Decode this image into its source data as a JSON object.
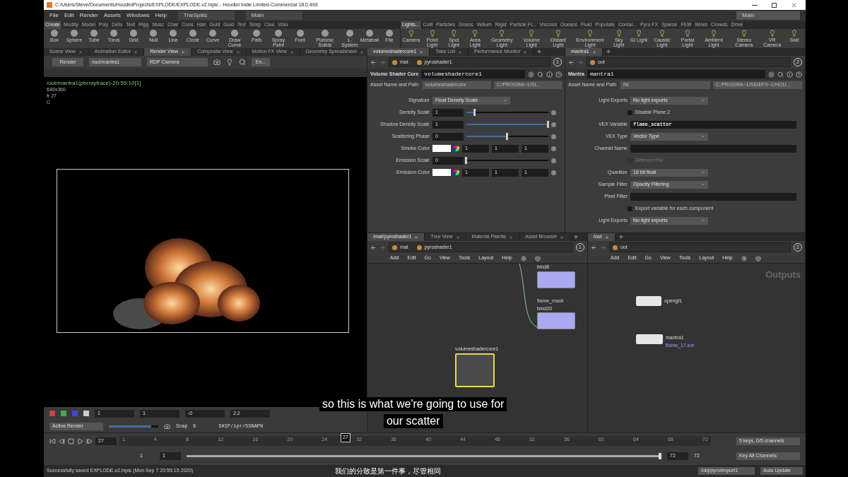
{
  "window": {
    "title": "C:/Users/Steve/Documents/HoudiniProjects/EXPLODE/EXPLODE.v2.hiplc - Houdini Indie Limited-Commercial 18.0.499"
  },
  "menu": [
    "File",
    "Edit",
    "Render",
    "Assets",
    "Windows",
    "Help"
  ],
  "desktops": [
    "TheSplits",
    "Main"
  ],
  "desktop_right": "Main",
  "shelf_left": {
    "tabs": [
      {
        "label": "Create",
        "selected": true
      },
      {
        "label": "Modify",
        "selected": false
      },
      {
        "label": "Model",
        "selected": false
      },
      {
        "label": "Poly",
        "selected": false
      },
      {
        "label": "Defo",
        "selected": false
      },
      {
        "label": "Text",
        "selected": false
      },
      {
        "label": "Rigg",
        "selected": false
      },
      {
        "label": "Musc",
        "selected": false
      },
      {
        "label": "Char",
        "selected": false
      },
      {
        "label": "Cons",
        "selected": false
      },
      {
        "label": "Hair",
        "selected": false
      },
      {
        "label": "Guid",
        "selected": false
      },
      {
        "label": "Guid",
        "selected": false
      },
      {
        "label": "Terr",
        "selected": false
      },
      {
        "label": "Simp",
        "selected": false
      },
      {
        "label": "Clou",
        "selected": false
      },
      {
        "label": "Volu",
        "selected": false
      }
    ],
    "tools": [
      "Box",
      "Sphere",
      "Tube",
      "Torus",
      "Grid",
      "Null",
      "Line",
      "Circle",
      "Curve",
      "Draw Curve",
      "Path",
      "Spray Paint",
      "Font",
      "Platonic Solids",
      "L-System",
      "Metaball",
      "File"
    ]
  },
  "shelf_right": {
    "tabs": [
      {
        "label": "Lights...",
        "selected": true
      },
      {
        "label": "Colli",
        "selected": false
      },
      {
        "label": "Particles",
        "selected": false
      },
      {
        "label": "Grains",
        "selected": false
      },
      {
        "label": "Vellum",
        "selected": false
      },
      {
        "label": "Rigid",
        "selected": false
      },
      {
        "label": "Particle Fl...",
        "selected": false
      },
      {
        "label": "Viscous",
        "selected": false
      },
      {
        "label": "Oceans",
        "selected": false
      },
      {
        "label": "Fluid",
        "selected": false
      },
      {
        "label": "Populate",
        "selected": false
      },
      {
        "label": "Contai...",
        "selected": false
      },
      {
        "label": "Pyro FX",
        "selected": false
      },
      {
        "label": "Sparse",
        "selected": false
      },
      {
        "label": "FEM",
        "selected": false
      },
      {
        "label": "Wires",
        "selected": false
      },
      {
        "label": "Crowds",
        "selected": false
      },
      {
        "label": "Drive",
        "selected": false
      }
    ],
    "tools": [
      "Camera",
      "Point Light",
      "Spot Light",
      "Area Light",
      "Geometry Light",
      "Volume Light",
      "Distant Light",
      "Environment Light",
      "Sky Light",
      "GI Light",
      "Caustic Light",
      "Portal Light",
      "Ambient Light",
      "Stereo Camera",
      "VR Camera",
      "Swit"
    ]
  },
  "viewer": {
    "tabs": [
      {
        "label": "Scene View",
        "selected": false
      },
      {
        "label": "Animation Editor",
        "selected": false
      },
      {
        "label": "Render View",
        "selected": true
      },
      {
        "label": "Composite View",
        "selected": false
      },
      {
        "label": "Motion FX View",
        "selected": false
      },
      {
        "label": "Geometry Spreadsheet",
        "selected": false
      }
    ],
    "render_button": "Render",
    "output": "/out/mantra1",
    "camera": "RDP Camera",
    "en_button": "En...",
    "info": [
      "/out/mantra1(pbrraytrace)-20:55:10[1]",
      "640x360",
      "fr 27",
      "C"
    ],
    "controls": [
      "1",
      "1",
      "-0",
      "2.2"
    ],
    "active_render": "Active Render",
    "snapshot_slider": {
      "level": 0.85
    },
    "snap": "Snap",
    "snap_value": "6",
    "snapshot_path": "SHIP/ipr/SSNAPN"
  },
  "params_panel": {
    "tabs": [
      {
        "label": "volumeshadercore1",
        "selected": true
      },
      {
        "label": "Take List",
        "selected": false
      },
      {
        "label": "Performance Monitor",
        "selected": false
      }
    ],
    "path": [
      "mat",
      "pyroshader1"
    ],
    "pin": "1",
    "node_type": "Volume Shader Core",
    "node_name": "volumeshadercore1",
    "asset_label": "Asset Name and Path",
    "asset_name": "volumeshadercore",
    "asset_path": "C:/PROGRA~1/SI...",
    "params": [
      {
        "kind": "menu",
        "label": "Signature",
        "value": "Float Density Scale"
      },
      {
        "kind": "slider",
        "label": "Density Scale",
        "value": "1",
        "level": 0.1
      },
      {
        "kind": "slider",
        "label": "Shadow Density Scale",
        "value": "1",
        "level": 1
      },
      {
        "kind": "slider",
        "label": "Scattering Phase",
        "value": "0",
        "level": 0.5
      },
      {
        "kind": "color",
        "label": "Smoke Color",
        "values": [
          "1",
          "1",
          "1"
        ]
      },
      {
        "kind": "slider",
        "label": "Emission Scale",
        "value": "0",
        "level": 0
      },
      {
        "kind": "color",
        "label": "Emission Color",
        "values": [
          "1",
          "1",
          "1"
        ]
      }
    ]
  },
  "mantra_panel": {
    "tabs": [
      {
        "label": "mantra1",
        "selected": true
      }
    ],
    "path": [
      "out"
    ],
    "pin": "2",
    "node_type": "Mantra",
    "node_name": "mantra1",
    "asset_label": "Asset Name and Path",
    "asset_name": "ifd",
    "asset_path": "C:/PROGRA~1/SIDEFX~1/HOU...",
    "params": [
      {
        "kind": "menu",
        "label": "Light Exports",
        "value": "No light exports"
      },
      {
        "kind": "checkbox",
        "label": "Disable Plane 2",
        "checked": false,
        "disabled": false
      },
      {
        "kind": "field",
        "label": "VEX Variable",
        "value": "flame_scatter"
      },
      {
        "kind": "menu",
        "label": "VEX Type",
        "value": "Vector Type"
      },
      {
        "kind": "field",
        "label": "Channel Name"
      },
      {
        "kind": "checkbox",
        "label": "Different File",
        "checked": false,
        "disabled": true
      },
      {
        "kind": "menu",
        "label": "Quantize",
        "value": "16 bit float"
      },
      {
        "kind": "menu",
        "label": "Sample Filter",
        "value": "Opacity Filtering"
      },
      {
        "kind": "field",
        "label": "Pixel Filter"
      },
      {
        "kind": "checkbox",
        "label": "Export variable for each component",
        "checked": false,
        "disabled": false
      },
      {
        "kind": "menu",
        "label": "Light Exports",
        "value": "No light exports"
      }
    ]
  },
  "network_left": {
    "tabs": [
      {
        "label": "/mat/pyroshader1",
        "selected": true
      },
      {
        "label": "Tree View",
        "selected": false
      },
      {
        "label": "Material Palette",
        "selected": false
      },
      {
        "label": "Asset Browser",
        "selected": false
      }
    ],
    "path": [
      "mat",
      "pyroshader1"
    ],
    "pin": "1",
    "menu": [
      "Add",
      "Edit",
      "Go",
      "View",
      "Tools",
      "Layout",
      "Help"
    ],
    "nodes": [
      {
        "label": "bind8",
        "selected": false
      },
      {
        "sublabel": "flame_mask",
        "label": "bind20",
        "selected": false
      },
      {
        "label": "volumeshadercore1",
        "selected": true
      }
    ]
  },
  "network_right": {
    "tabs": [
      {
        "label": "/out",
        "selected": true
      }
    ],
    "path": [
      "out"
    ],
    "pin": "2",
    "menu": [
      "Add",
      "Edit",
      "Go",
      "View",
      "Tools",
      "Layout",
      "Help"
    ],
    "context_label": "Outputs",
    "nodes": [
      {
        "label": "opengl1"
      },
      {
        "label": "mantra1",
        "output": "flame_17.exr"
      }
    ]
  },
  "subtitles": [
    "so this is what we're going to use for",
    "our scatter"
  ],
  "timeline": {
    "frame": "27",
    "marker": "27",
    "ruler": [
      "1",
      "4",
      "8",
      "12",
      "16",
      "20",
      "24",
      "32",
      "36",
      "40",
      "44",
      "48",
      "52",
      "56",
      "60",
      "64",
      "68",
      "72"
    ],
    "range_slider": {
      "level": 1
    },
    "range_start": "1",
    "start": "1",
    "end": "72",
    "range_end": "72",
    "keys": "5 keys, 0/5 channels",
    "key_all": "Key All Channels"
  },
  "status_bar": {
    "message": "Successfully saved EXPLODE.v2.hiplc (Mon Sep  7 20:55:15 2020)",
    "subtitle": "我们的分散是第一件事，尽管相同",
    "path": "/obj/pyro/import1",
    "update": "Auto Update"
  }
}
